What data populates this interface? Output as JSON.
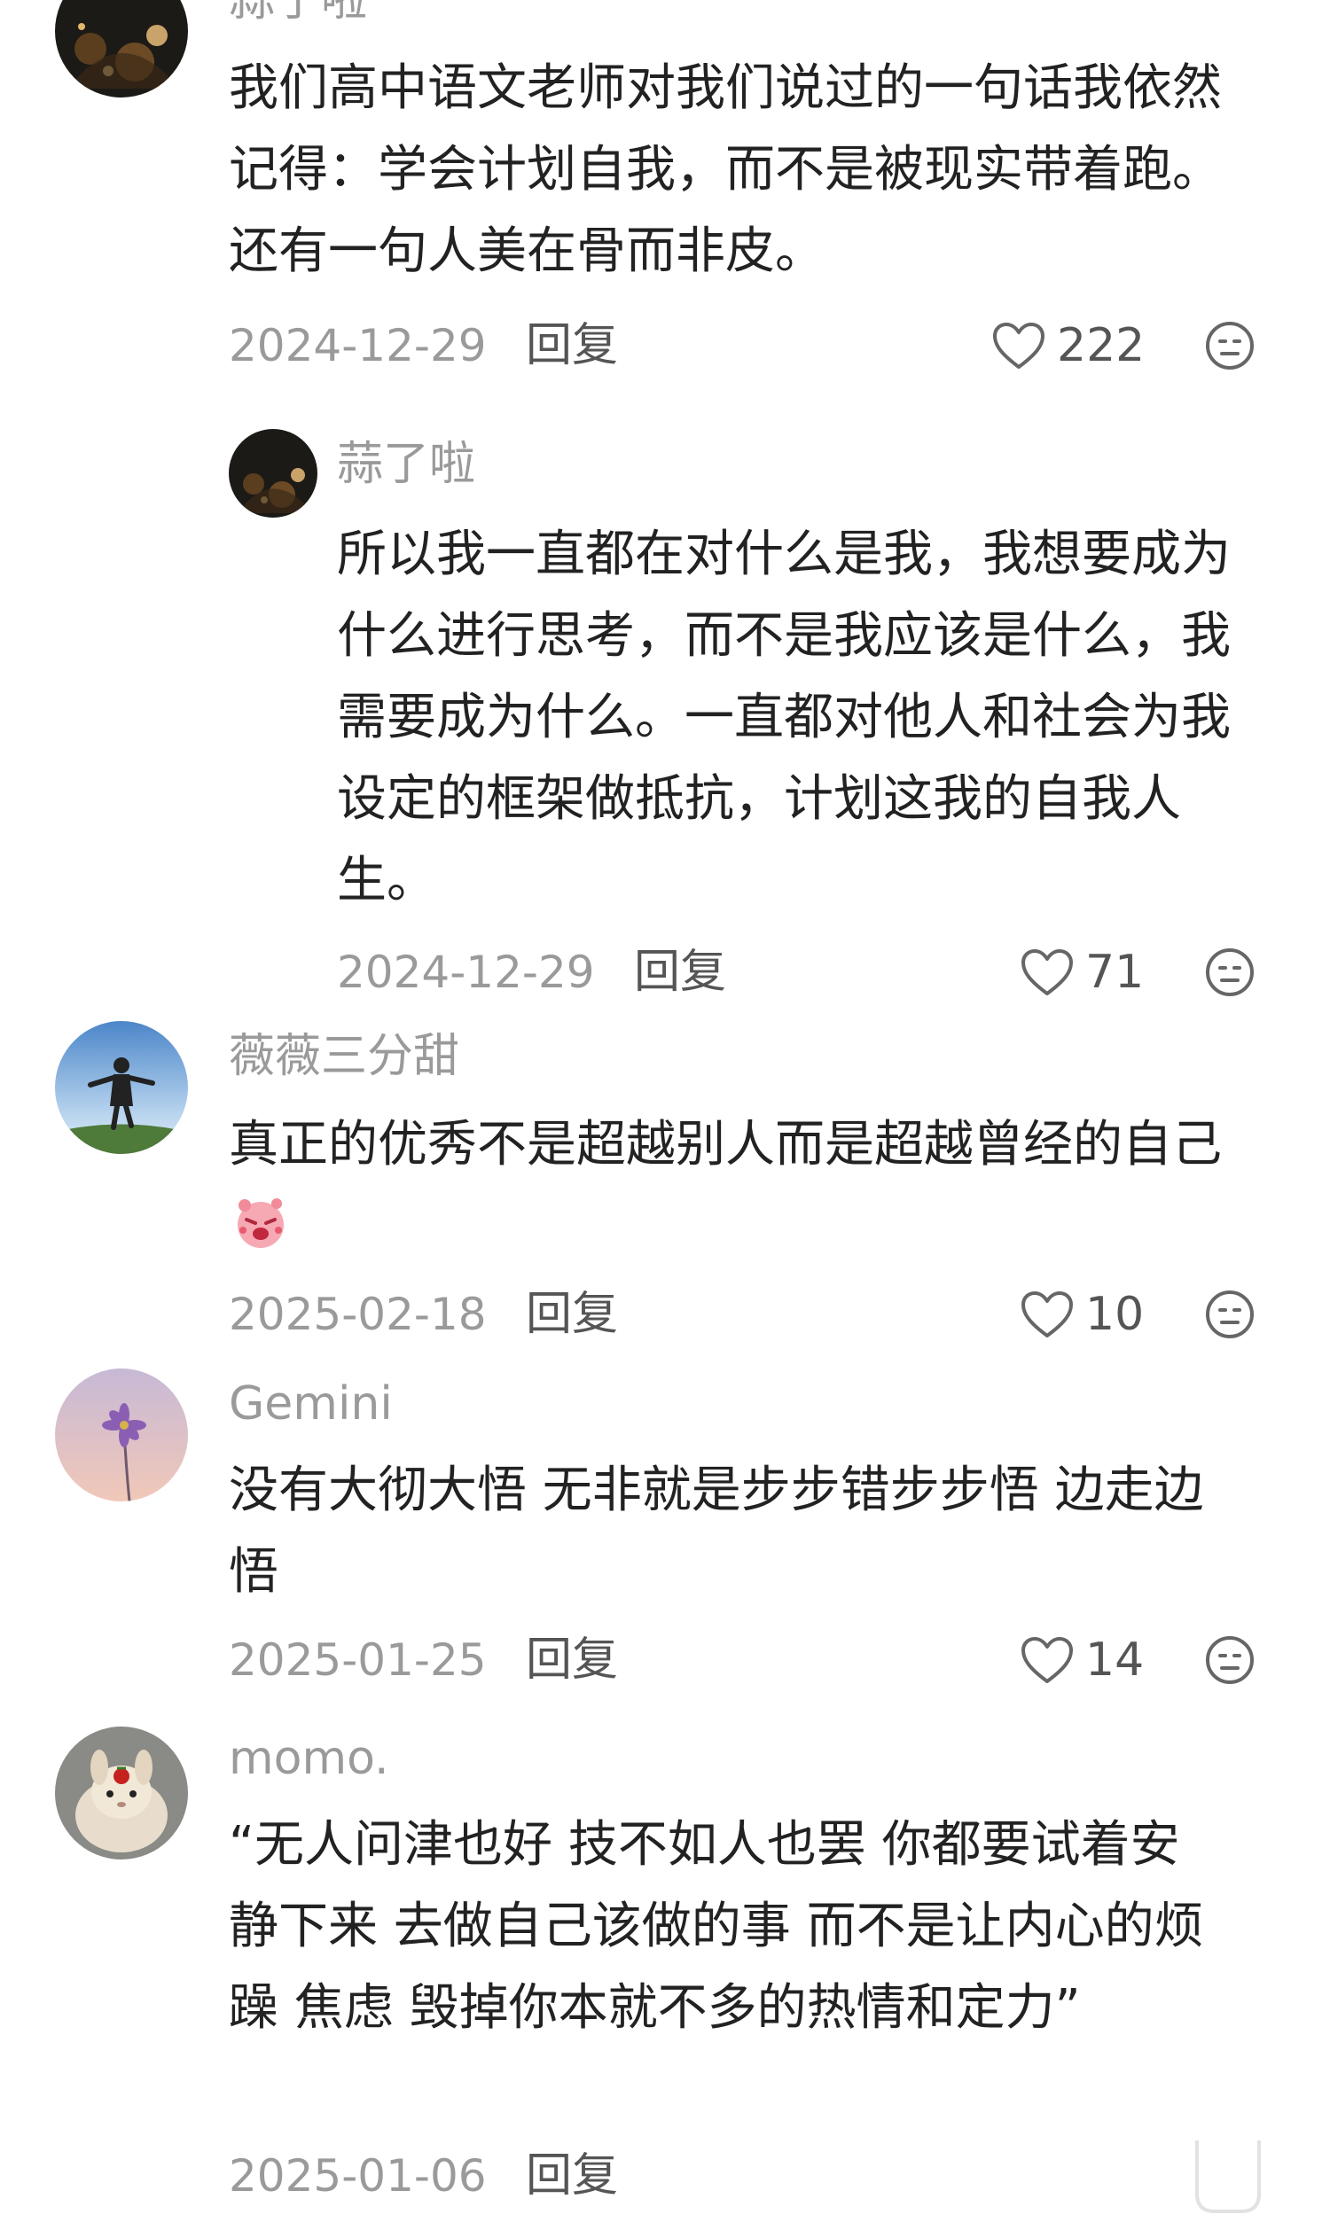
{
  "comments": [
    {
      "username": "蒜了啦",
      "lines": [
        "我们高中语文老师对我们说过的一句话我依然",
        "记得：学会计划自我，而不是被现实带着跑。",
        "还有一句人美在骨而非皮。"
      ],
      "date": "2024-12-29",
      "reply": "回复",
      "likes": "222"
    },
    {
      "username": "蒜了啦",
      "lines": [
        "所以我一直都在对什么是我，我想要成为",
        "什么进行思考，而不是我应该是什么，我",
        "需要成为什么。一直都对他人和社会为我",
        "设定的框架做抵抗，计划这我的自我人",
        "生。"
      ],
      "date": "2024-12-29",
      "reply": "回复",
      "likes": "71"
    },
    {
      "username": "薇薇三分甜",
      "lines": [
        "真正的优秀不是超越别人而是超越曾经的自己"
      ],
      "date": "2025-02-18",
      "reply": "回复",
      "likes": "10"
    },
    {
      "username": "Gemini",
      "lines": [
        "没有大彻大悟 无非就是步步错步步悟 边走边",
        "悟"
      ],
      "date": "2025-01-25",
      "reply": "回复",
      "likes": "14"
    },
    {
      "username": "momo.",
      "lines": [
        "“无人问津也好 技不如人也罢 你都要试着安",
        "静下来 去做自己该做的事 而不是让内心的烦",
        "躁 焦虑 毁掉你本就不多的热情和定力”"
      ],
      "date": "2025-01-06",
      "reply": "回复"
    }
  ],
  "icons": {
    "like": "heart-outline-icon",
    "dislike": "neutral-face-icon",
    "sticker": "pink-crying-face-emoji"
  },
  "colors": {
    "meta_gray": "#9a9a9a",
    "text": "#222222",
    "action_gray": "#555555"
  }
}
